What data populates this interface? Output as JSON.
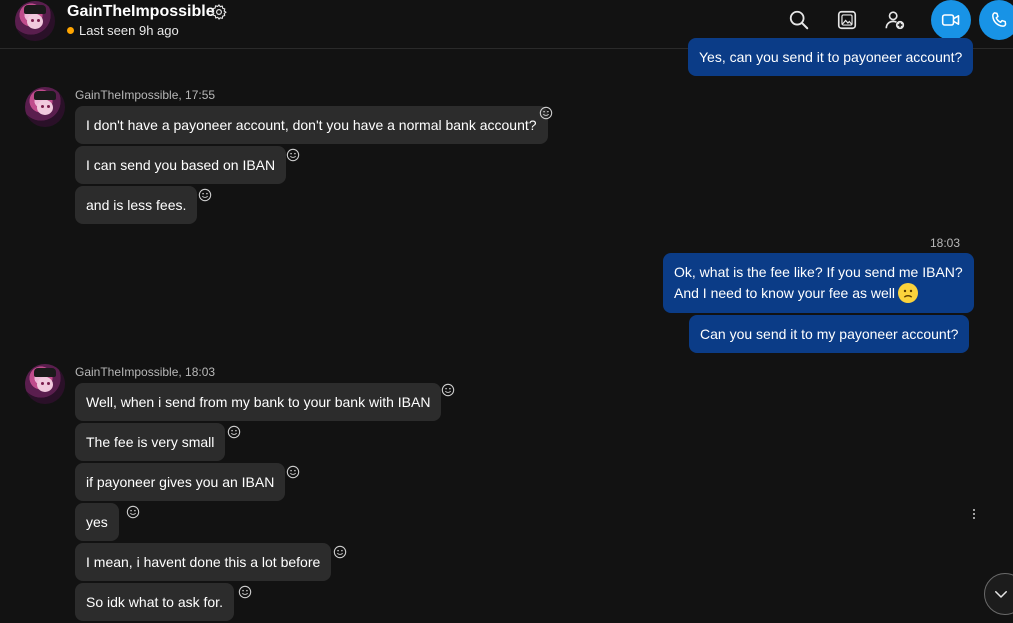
{
  "header": {
    "contact_name": "GainTheImpossible",
    "status": "Last seen 9h ago",
    "status_color": "#ffa500"
  },
  "icons": {
    "settings": "gear-icon",
    "search": "search-icon",
    "gallery": "gallery-icon",
    "add_people": "add-person-icon",
    "video_call": "video-call-icon",
    "audio_call": "phone-icon",
    "reaction": "smiley-icon",
    "more": "more-vertical-icon",
    "scroll_down": "chevron-down-icon"
  },
  "colors": {
    "accent": "#1893e6",
    "outgoing_bubble": "#0b3c87",
    "incoming_bubble": "#2c2c2c",
    "background": "#121212"
  },
  "messages": {
    "out_top": "Yes, can you send it to payoneer account?",
    "group1_meta": "GainTheImpossible, 17:55",
    "g1": [
      "I don't have a payoneer account, don't you have a normal bank account?",
      "I can send you based on IBAN",
      "and is less fees."
    ],
    "out_time": "18:03",
    "out_lines": [
      "Ok, what is the fee like? If you send me IBAN?",
      "And I need to know your fee as well"
    ],
    "out_last": "Can you send it to my payoneer account?",
    "group2_meta": "GainTheImpossible, 18:03",
    "g2": [
      "Well, when i send from my bank to your bank with IBAN",
      "The fee is very small",
      "if payoneer gives you an IBAN",
      "yes",
      "I mean, i havent done this a lot before",
      "So idk what to ask for."
    ]
  }
}
